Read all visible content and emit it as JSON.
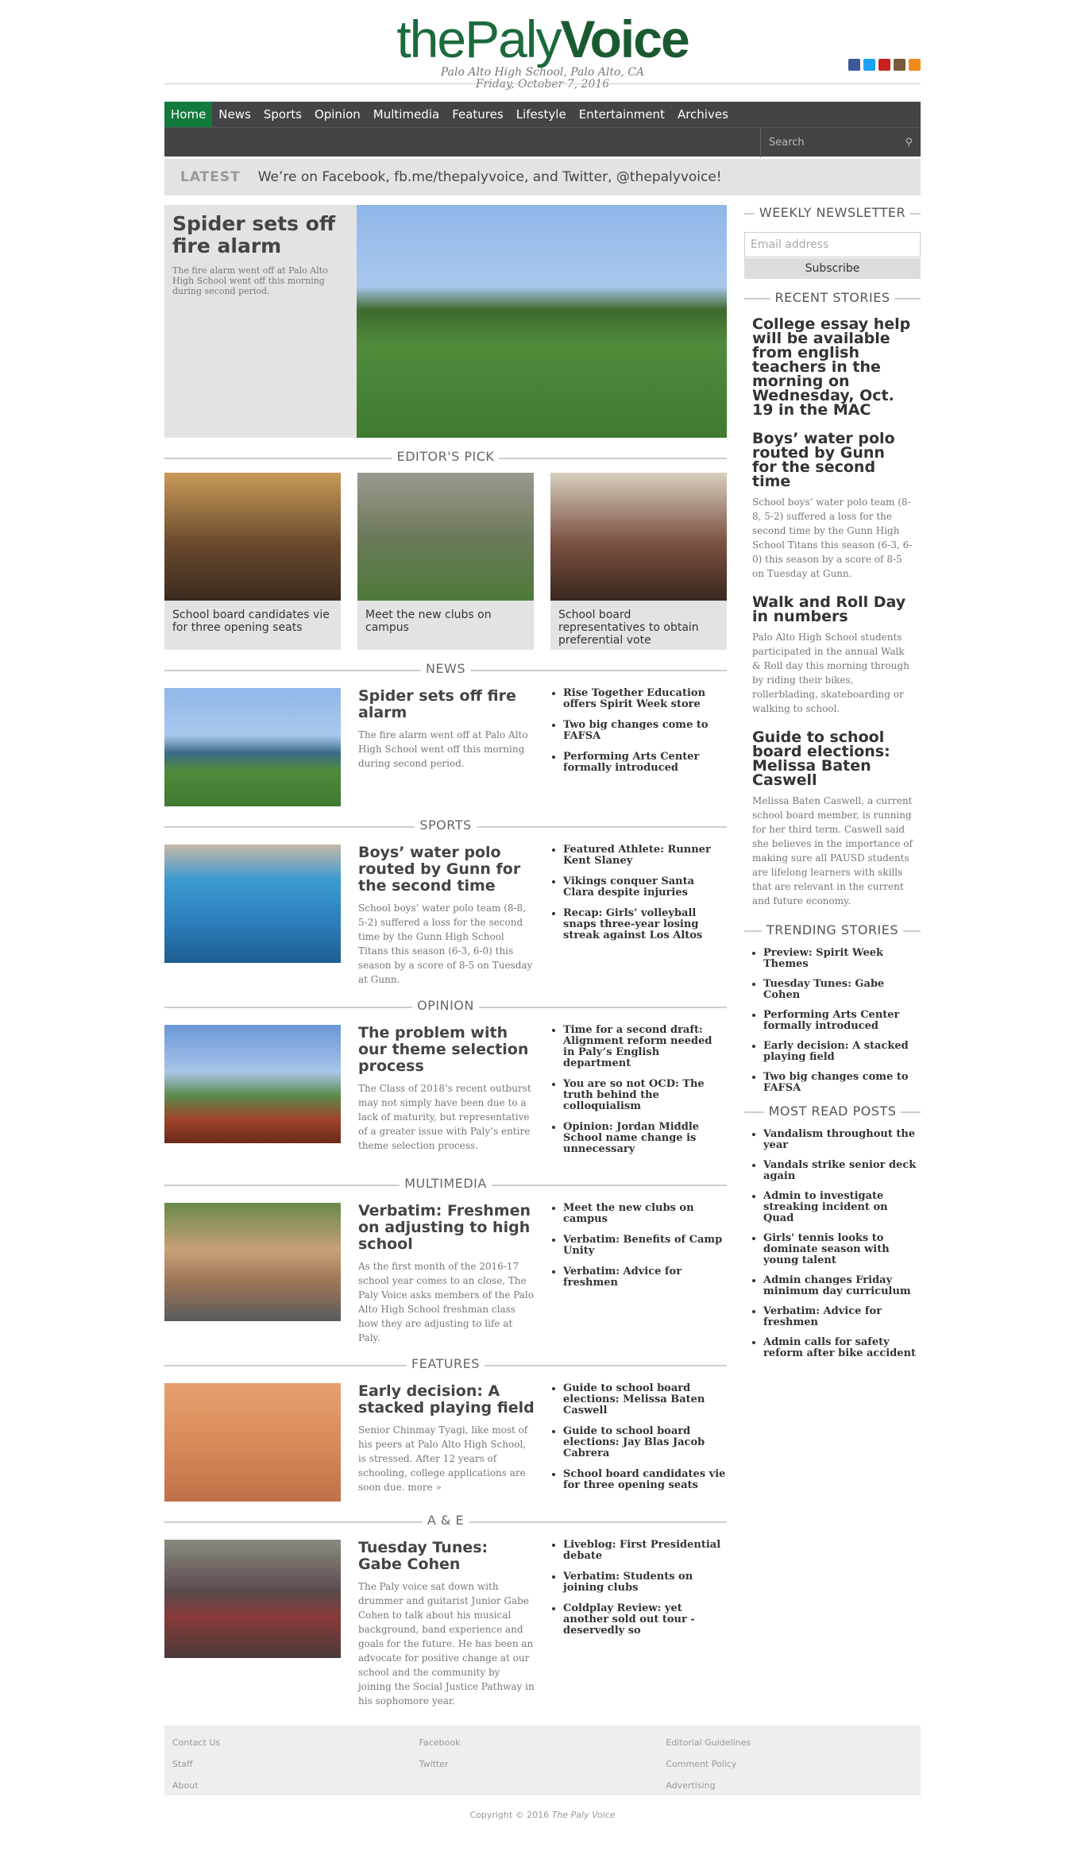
{
  "header": {
    "logo_light": "thePaly",
    "logo_bold": "Voice",
    "school": "Palo Alto High School, Palo Alto, CA",
    "date": "Friday, October 7, 2016",
    "social": [
      "facebook-icon",
      "twitter-icon",
      "youtube-icon",
      "instagram-icon",
      "rss-icon"
    ]
  },
  "nav": {
    "items": [
      "Home",
      "News",
      "Sports",
      "Opinion",
      "Multimedia",
      "Features",
      "Lifestyle",
      "Entertainment",
      "Archives"
    ],
    "search_placeholder": "Search"
  },
  "latest": {
    "label": "LATEST",
    "text": "We’re on Facebook, fb.me/thepalyvoice, and Twitter, @thepalyvoice!"
  },
  "feature": {
    "title": "Spider sets off fire alarm",
    "summary": "The fire alarm went off at Palo Alto High School went off this morning during second period."
  },
  "editors_pick": {
    "heading": "EDITOR'S PICK",
    "items": [
      "School board candidates vie for three opening seats",
      "Meet the new clubs on campus",
      "School board representatives to obtain preferential vote"
    ]
  },
  "sections": [
    {
      "heading": "NEWS",
      "title": "Spider sets off fire alarm",
      "summary": "The fire alarm went off at Palo Alto High School went off this morning during second period.",
      "links": [
        "Rise Together Education offers Spirit Week store",
        "Two big changes come to FAFSA",
        "Performing Arts Center formally introduced"
      ]
    },
    {
      "heading": "SPORTS",
      "title": "Boys’ water polo routed by Gunn for the second time",
      "summary": "School boys’ water polo team (8-8, 5-2) suffered a loss for the second time by the Gunn High School Titans this season (6-3, 6-0) this season by a score of 8-5 on Tuesday at Gunn.",
      "links": [
        "Featured Athlete: Runner Kent Slaney",
        "Vikings conquer Santa Clara despite injuries",
        "Recap: Girls’ volleyball snaps three-year losing streak against Los Altos"
      ]
    },
    {
      "heading": "OPINION",
      "title": "The problem with our theme selection process",
      "summary": "The Class of 2018’s recent outburst may not simply have been due to a lack of maturity, but representative of a greater issue with Paly’s entire theme selection process.",
      "links": [
        "Time for a second draft: Alignment reform needed in Paly’s English department",
        "You are so not OCD: The truth behind the colloquialism",
        "Opinion: Jordan Middle School name change is unnecessary"
      ]
    },
    {
      "heading": "MULTIMEDIA",
      "title": "Verbatim: Freshmen on adjusting to high school",
      "summary": "As the first month of the 2016-17 school year comes to an close, The Paly Voice asks members of the Palo Alto High School freshman class how they are adjusting to life at Paly.",
      "links": [
        "Meet the new clubs on campus",
        "Verbatim: Benefits of Camp Unity",
        "Verbatim: Advice for freshmen"
      ]
    },
    {
      "heading": "FEATURES",
      "title": "Early decision: A stacked playing field",
      "summary": "Senior Chinmay Tyagi, like most of his peers at Palo Alto High School, is stressed. After 12 years of schooling, college applications are soon due. more »",
      "links": [
        "Guide to school board elections: Melissa Baten Caswell",
        "Guide to school board elections: Jay Blas Jacob Cabrera",
        "School board candidates vie for three opening seats"
      ]
    },
    {
      "heading": "A & E",
      "title": "Tuesday Tunes: Gabe Cohen",
      "summary": "The Paly voice sat down with drummer and guitarist Junior Gabe Cohen to talk about his musical background, band experience and goals for the future. He has been an advocate for positive change at our school and the community by joining the Social Justice Pathway in his sophomore year.",
      "links": [
        "Liveblog: First Presidential debate",
        "Verbatim: Students on joining clubs",
        "Coldplay Review: yet another sold out tour - deservedly so"
      ]
    }
  ],
  "sidebar": {
    "newsletter_heading": "WEEKLY NEWSLETTER",
    "email_placeholder": "Email address",
    "subscribe_label": "Subscribe",
    "recent_heading": "RECENT STORIES",
    "recent": [
      {
        "title": "College essay help will be available from english teachers in the morning on Wednesday, Oct. 19 in the MAC",
        "summary": ""
      },
      {
        "title": "Boys’ water polo routed by Gunn for the second time",
        "summary": "School boys’ water polo team (8-8, 5-2) suffered a loss for the second time by the Gunn High School Titans this season (6-3, 6-0) this season by a score of 8-5 on Tuesday at Gunn."
      },
      {
        "title": "Walk and Roll Day in numbers",
        "summary": "Palo Alto High School students participated in the annual Walk & Roll day this morning through by riding their bikes, rollerblading, skateboarding or walking to school."
      },
      {
        "title": "Guide to school board elections: Melissa Baten Caswell",
        "summary": "Melissa Baten Caswell, a current school board member, is running for her third term. Caswell said she believes in the importance of making sure all PAUSD students are lifelong learners with skills that are relevant in the current and future economy."
      }
    ],
    "trending_heading": "TRENDING STORIES",
    "trending": [
      "Preview: Spirit Week Themes",
      "Tuesday Tunes: Gabe Cohen",
      "Performing Arts Center formally introduced",
      "Early decision: A stacked playing field",
      "Two big changes come to FAFSA"
    ],
    "mostread_heading": "MOST READ POSTS",
    "mostread": [
      "Vandalism throughout the year",
      "Vandals strike senior deck again",
      "Admin to investigate streaking incident on Quad",
      "Girls' tennis looks to dominate season with young talent",
      "Admin changes Friday minimum day curriculum",
      "Verbatim: Advice for freshmen",
      "Admin calls for safety reform after bike accident"
    ]
  },
  "footer": {
    "col1": [
      "Contact Us",
      "Staff",
      "About"
    ],
    "col2": [
      "Facebook",
      "Twitter"
    ],
    "col3": [
      "Editorial Guidelines",
      "Comment Policy",
      "Advertising"
    ],
    "copyright": "Copyright © 2016",
    "copyright_name": "The Paly Voice"
  }
}
